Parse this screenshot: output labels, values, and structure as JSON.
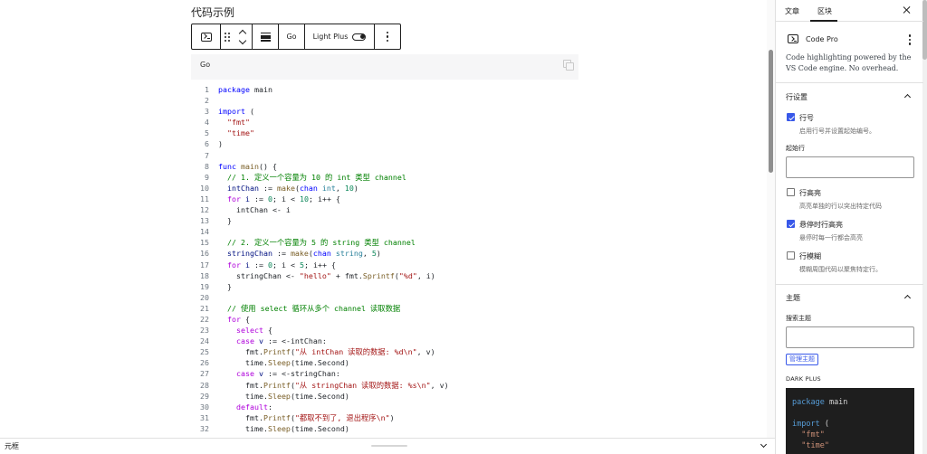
{
  "page": {
    "title": "代码示例"
  },
  "toolbar": {
    "language_label": "Go",
    "theme_label": "Light Plus"
  },
  "code_block": {
    "language": "Go",
    "lines": [
      [
        [
          "kw",
          "package"
        ],
        [
          "p",
          " main"
        ]
      ],
      [],
      [
        [
          "kw",
          "import"
        ],
        [
          "p",
          " ("
        ]
      ],
      [
        [
          "p",
          "  "
        ],
        [
          "st",
          "\"fmt\""
        ]
      ],
      [
        [
          "p",
          "  "
        ],
        [
          "st",
          "\"time\""
        ]
      ],
      [
        [
          "p",
          ")"
        ]
      ],
      [],
      [
        [
          "kw",
          "func"
        ],
        [
          "p",
          " "
        ],
        [
          "fn",
          "main"
        ],
        [
          "p",
          "() {"
        ]
      ],
      [
        [
          "p",
          "  "
        ],
        [
          "cm",
          "// 1. 定义一个容量为 10 的 int 类型 channel"
        ]
      ],
      [
        [
          "p",
          "  "
        ],
        [
          "va",
          "intChan"
        ],
        [
          "p",
          " := "
        ],
        [
          "fn",
          "make"
        ],
        [
          "p",
          "("
        ],
        [
          "kw",
          "chan"
        ],
        [
          "p",
          " "
        ],
        [
          "ty",
          "int"
        ],
        [
          "p",
          ", "
        ],
        [
          "nu",
          "10"
        ],
        [
          "p",
          ")"
        ]
      ],
      [
        [
          "p",
          "  "
        ],
        [
          "ctl",
          "for"
        ],
        [
          "p",
          " "
        ],
        [
          "va",
          "i"
        ],
        [
          "p",
          " := "
        ],
        [
          "nu",
          "0"
        ],
        [
          "p",
          "; i < "
        ],
        [
          "nu",
          "10"
        ],
        [
          "p",
          "; i++ {"
        ]
      ],
      [
        [
          "p",
          "    intChan <- i"
        ]
      ],
      [
        [
          "p",
          "  }"
        ]
      ],
      [],
      [
        [
          "p",
          "  "
        ],
        [
          "cm",
          "// 2. 定义一个容量为 5 的 string 类型 channel"
        ]
      ],
      [
        [
          "p",
          "  "
        ],
        [
          "va",
          "stringChan"
        ],
        [
          "p",
          " := "
        ],
        [
          "fn",
          "make"
        ],
        [
          "p",
          "("
        ],
        [
          "kw",
          "chan"
        ],
        [
          "p",
          " "
        ],
        [
          "ty",
          "string"
        ],
        [
          "p",
          ", "
        ],
        [
          "nu",
          "5"
        ],
        [
          "p",
          ")"
        ]
      ],
      [
        [
          "p",
          "  "
        ],
        [
          "ctl",
          "for"
        ],
        [
          "p",
          " "
        ],
        [
          "va",
          "i"
        ],
        [
          "p",
          " := "
        ],
        [
          "nu",
          "0"
        ],
        [
          "p",
          "; i < "
        ],
        [
          "nu",
          "5"
        ],
        [
          "p",
          "; i++ {"
        ]
      ],
      [
        [
          "p",
          "    stringChan <- "
        ],
        [
          "st",
          "\"hello\""
        ],
        [
          "p",
          " + fmt."
        ],
        [
          "fn",
          "Sprintf"
        ],
        [
          "p",
          "("
        ],
        [
          "st",
          "\"%d\""
        ],
        [
          "p",
          ", i)"
        ]
      ],
      [
        [
          "p",
          "  }"
        ]
      ],
      [],
      [
        [
          "p",
          "  "
        ],
        [
          "cm",
          "// 使用 select 循环从多个 channel 读取数据"
        ]
      ],
      [
        [
          "p",
          "  "
        ],
        [
          "ctl",
          "for"
        ],
        [
          "p",
          " {"
        ]
      ],
      [
        [
          "p",
          "    "
        ],
        [
          "ctl",
          "select"
        ],
        [
          "p",
          " {"
        ]
      ],
      [
        [
          "p",
          "    "
        ],
        [
          "ctl",
          "case"
        ],
        [
          "p",
          " "
        ],
        [
          "va",
          "v"
        ],
        [
          "p",
          " := <-intChan:"
        ]
      ],
      [
        [
          "p",
          "      fmt."
        ],
        [
          "fn",
          "Printf"
        ],
        [
          "p",
          "("
        ],
        [
          "st",
          "\"从 intChan 读取的数据: %d\\n\""
        ],
        [
          "p",
          ", v)"
        ]
      ],
      [
        [
          "p",
          "      time."
        ],
        [
          "fn",
          "Sleep"
        ],
        [
          "p",
          "(time.Second)"
        ]
      ],
      [
        [
          "p",
          "    "
        ],
        [
          "ctl",
          "case"
        ],
        [
          "p",
          " "
        ],
        [
          "va",
          "v"
        ],
        [
          "p",
          " := <-stringChan:"
        ]
      ],
      [
        [
          "p",
          "      fmt."
        ],
        [
          "fn",
          "Printf"
        ],
        [
          "p",
          "("
        ],
        [
          "st",
          "\"从 stringChan 读取的数据: %s\\n\""
        ],
        [
          "p",
          ", v)"
        ]
      ],
      [
        [
          "p",
          "      time."
        ],
        [
          "fn",
          "Sleep"
        ],
        [
          "p",
          "(time.Second)"
        ]
      ],
      [
        [
          "p",
          "    "
        ],
        [
          "ctl",
          "default"
        ],
        [
          "p",
          ":"
        ]
      ],
      [
        [
          "p",
          "      fmt."
        ],
        [
          "fn",
          "Printf"
        ],
        [
          "p",
          "("
        ],
        [
          "st",
          "\"都取不到了, 退出程序\\n\""
        ],
        [
          "p",
          ")"
        ]
      ],
      [
        [
          "p",
          "      time."
        ],
        [
          "fn",
          "Sleep"
        ],
        [
          "p",
          "(time.Second)"
        ]
      ]
    ]
  },
  "footer": {
    "breadcrumb": "元框"
  },
  "sidebar": {
    "tabs": [
      "文章",
      "区块"
    ],
    "block": {
      "name": "Code Pro",
      "description": "Code highlighting powered by the VS Code engine. No overhead."
    },
    "line_settings": {
      "heading": "行设置",
      "options": [
        {
          "label": "行号",
          "help": "启用行号并设置起始编号。",
          "checked": true
        },
        {
          "label": "行高亮",
          "help": "高亮单独的行以突出特定代码",
          "checked": false
        },
        {
          "label": "悬停时行高亮",
          "help": "悬停时每一行都会高亮",
          "checked": true
        },
        {
          "label": "行模糊",
          "help": "模糊周围代码以聚焦特定行。",
          "checked": false
        }
      ],
      "start_line_label": "起始行",
      "start_line_value": ""
    },
    "theme": {
      "heading": "主题",
      "search_label": "搜索主题",
      "search_value": "",
      "manage_button": "管理主题",
      "preview_label": "DARK PLUS",
      "preview_lines": [
        [
          [
            "kw",
            "package"
          ],
          [
            "p",
            " main"
          ]
        ],
        [],
        [
          [
            "kw",
            "import"
          ],
          [
            "p",
            " ("
          ]
        ],
        [
          [
            "p",
            "  "
          ],
          [
            "st",
            "\"fmt\""
          ]
        ],
        [
          [
            "p",
            "  "
          ],
          [
            "st",
            "\"time\""
          ]
        ]
      ]
    }
  },
  "colors": {
    "accent": "#3858e9",
    "code_keyword": "#0000ff",
    "code_string": "#a31515",
    "code_comment": "#008000",
    "code_number": "#098658",
    "code_control": "#af00db",
    "code_function": "#795e26",
    "dark_preview_bg": "#1e1e1e"
  }
}
